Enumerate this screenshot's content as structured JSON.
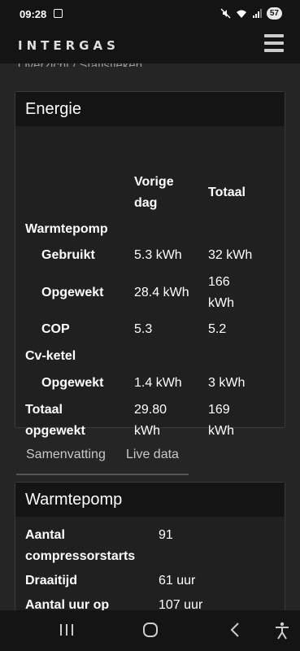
{
  "status": {
    "time": "09:28",
    "battery": "57"
  },
  "header": {
    "logo": "INTERGAS"
  },
  "breadcrumb": {
    "home": "Overzicht",
    "sep": "/",
    "current": "Statistieken"
  },
  "energy": {
    "title": "Energie",
    "col_prev_line1": "Vorige",
    "col_prev_line2": "dag",
    "col_total": "Totaal",
    "section_heatpump": "Warmtepomp",
    "used_label": "Gebruikt",
    "used_prev": "5.3 kWh",
    "used_total": "32 kWh",
    "gen_label": "Opgewekt",
    "gen_prev": "28.4 kWh",
    "gen_total_line1": "166",
    "gen_total_line2": "kWh",
    "cop_label": "COP",
    "cop_prev": "5.3",
    "cop_total": "5.2",
    "section_boiler": "Cv-ketel",
    "boiler_gen_label": "Opgewekt",
    "boiler_gen_prev": "1.4 kWh",
    "boiler_gen_total": "3 kWh",
    "total_label_line1": "Totaal",
    "total_label_line2": "opgewekt",
    "total_prev_line1": "29.80",
    "total_prev_line2": "kWh",
    "total_total_line1": "169",
    "total_total_line2": "kWh"
  },
  "tabs": {
    "summary": "Samenvatting",
    "live": "Live data"
  },
  "heatpump": {
    "title": "Warmtepomp",
    "starts_label_line1": "Aantal",
    "starts_label_line2": "compressorstarts",
    "starts_value": "91",
    "runtime_label": "Draaitijd",
    "runtime_value": "61 uur",
    "hours_label": "Aantal uur op",
    "hours_value": "107 uur"
  }
}
